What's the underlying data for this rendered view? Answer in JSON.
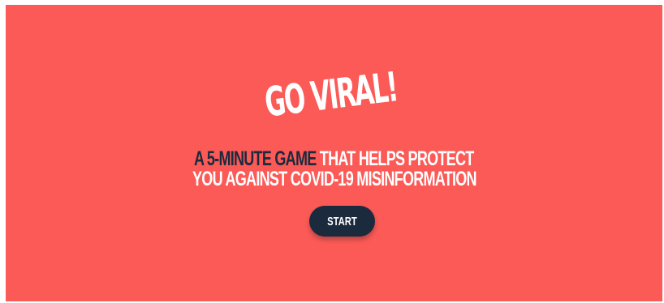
{
  "logo": {
    "text": "GO VIRAL!"
  },
  "tagline": {
    "line1_dark": "A 5-MINUTE GAME",
    "line1_light": " THAT HELPS PROTECT",
    "line2": "YOU AGAINST COVID-19 MISINFORMATION"
  },
  "start_button": {
    "label": "START"
  },
  "colors": {
    "background": "#fb5a57",
    "dark_text": "#1b2a3d",
    "light_text": "#ffffff",
    "button": "#1b2a3d"
  }
}
